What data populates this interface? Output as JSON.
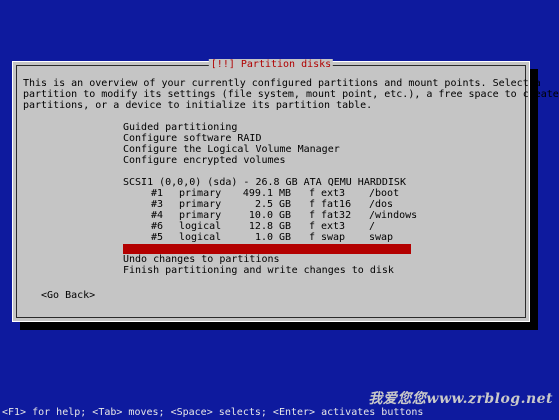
{
  "dialog": {
    "title": "[!!] Partition disks",
    "intro": "This is an overview of your currently configured partitions and mount points. Select a\npartition to modify its settings (file system, mount point, etc.), a free space to create\npartitions, or a device to initialize its partition table."
  },
  "menu": {
    "guided": "Guided partitioning",
    "raid": "Configure software RAID",
    "lvm": "Configure the Logical Volume Manager",
    "encrypted": "Configure encrypted volumes",
    "disk": "SCSI1 (0,0,0) (sda) - 26.8 GB ATA QEMU HARDDISK",
    "partitions": [
      {
        "num": "#1",
        "type": "primary",
        "size": "499.1",
        "unit": "MB",
        "flag": "f",
        "fs": "ext3",
        "mount": "/boot"
      },
      {
        "num": "#3",
        "type": "primary",
        "size": "2.5",
        "unit": "GB",
        "flag": "f",
        "fs": "fat16",
        "mount": "/dos"
      },
      {
        "num": "#4",
        "type": "primary",
        "size": "10.0",
        "unit": "GB",
        "flag": "f",
        "fs": "fat32",
        "mount": "/windows"
      },
      {
        "num": "#6",
        "type": "logical",
        "size": "12.8",
        "unit": "GB",
        "flag": "f",
        "fs": "ext3",
        "mount": "/"
      },
      {
        "num": "#5",
        "type": "logical",
        "size": "1.0",
        "unit": "GB",
        "flag": "f",
        "fs": "swap",
        "mount": "swap"
      }
    ],
    "undo": "Undo changes to partitions",
    "finish": "Finish partitioning and write changes to disk"
  },
  "buttons": {
    "go_back": "<Go Back>"
  },
  "statusbar": {
    "help": "<F1> for help; <Tab> moves; <Space> selects; <Enter> activates buttons"
  },
  "watermark": {
    "text": "我爱您您www.zrblog.net"
  },
  "colors": {
    "background": "#0e1a9e",
    "dialog": "#c5c5c5",
    "title": "#b00000",
    "selection": "#b30000"
  }
}
